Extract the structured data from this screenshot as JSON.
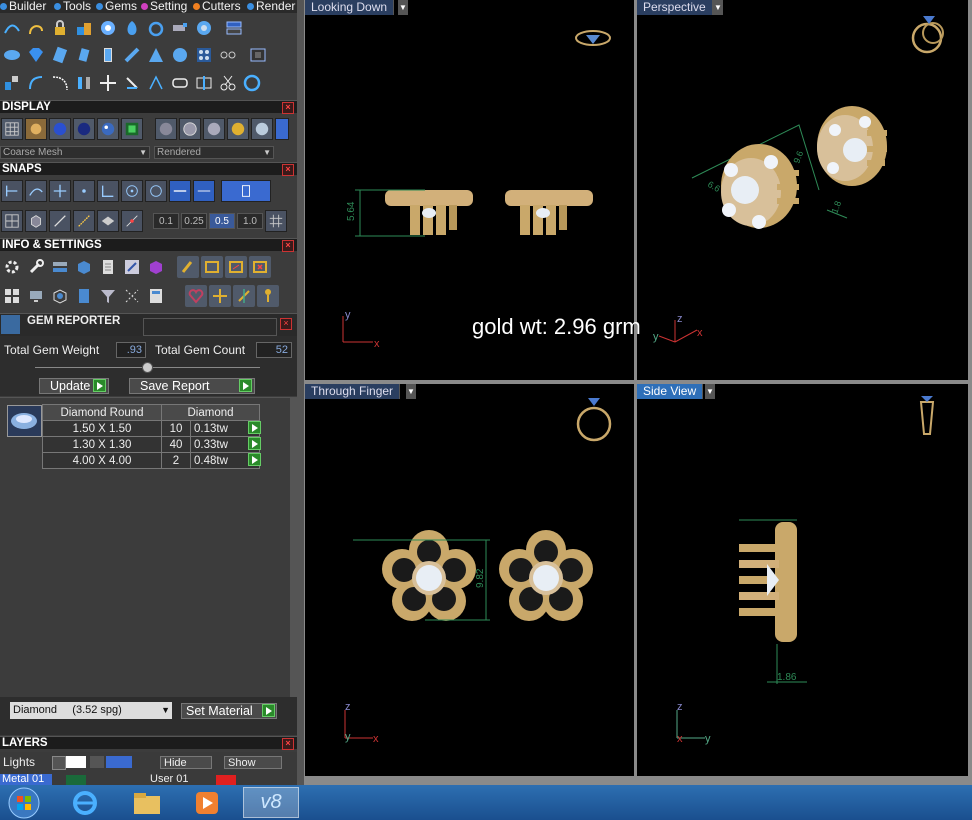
{
  "menubar": {
    "items": [
      {
        "label": "Builder",
        "dot": "#3a8ee0"
      },
      {
        "label": "Tools",
        "dot": "#3a8ee0"
      },
      {
        "label": "Gems",
        "dot": "#3a8ee0"
      },
      {
        "label": "Setting",
        "dot": "#d040c0"
      },
      {
        "label": "Cutters",
        "dot": "#f08020"
      },
      {
        "label": "Render",
        "dot": "#3a8ee0"
      }
    ]
  },
  "sections": {
    "display": "DISPLAY",
    "snaps": "SNAPS",
    "info": "INFO & SETTINGS",
    "gem_reporter": "GEM REPORTER",
    "layers": "LAYERS"
  },
  "display": {
    "mesh_select": "Coarse Mesh",
    "render_select": "Rendered"
  },
  "snaps": {
    "values": [
      "0.1",
      "0.25",
      "0.5",
      "1.0"
    ]
  },
  "gem_reporter": {
    "total_weight_label": "Total Gem Weight",
    "total_weight_value": ".93",
    "total_count_label": "Total Gem Count",
    "total_count_value": "52",
    "update_label": "Update",
    "save_report_label": "Save Report",
    "table": {
      "col1": "Diamond Round",
      "col2": "Diamond",
      "rows": [
        {
          "size": "1.50 X 1.50",
          "count": "10",
          "weight": "0.13tw"
        },
        {
          "size": "1.30 X 1.30",
          "count": "40",
          "weight": "0.33tw"
        },
        {
          "size": "4.00 X 4.00",
          "count": "2",
          "weight": "0.48tw"
        }
      ]
    },
    "material_select": "Diamond     (3.52 spg)",
    "set_material_label": "Set Material"
  },
  "layers": {
    "lights_label": "Lights",
    "hide_label": "Hide",
    "show_label": "Show",
    "metal_label": "Metal 01",
    "user_label": "User 01"
  },
  "viewports": {
    "top_left": {
      "title": "Looking Down",
      "dimension": "5.64"
    },
    "top_right": {
      "title": "Perspective",
      "dims": [
        "9.6",
        "6.6",
        "1.8"
      ]
    },
    "bottom_left": {
      "title": "Through Finger",
      "dimension": "9.82"
    },
    "bottom_right": {
      "title": "Side View",
      "dimension": "1.86"
    },
    "overlay_text": "gold wt: 2.96 grm"
  },
  "axes": {
    "x": "x",
    "y": "y",
    "z": "z"
  },
  "taskbar": {
    "active_app": "v8"
  },
  "colors": {
    "gold": "#c9a86a",
    "dim_green": "#2e8b57",
    "viewport_border": "#8a8a8a"
  }
}
